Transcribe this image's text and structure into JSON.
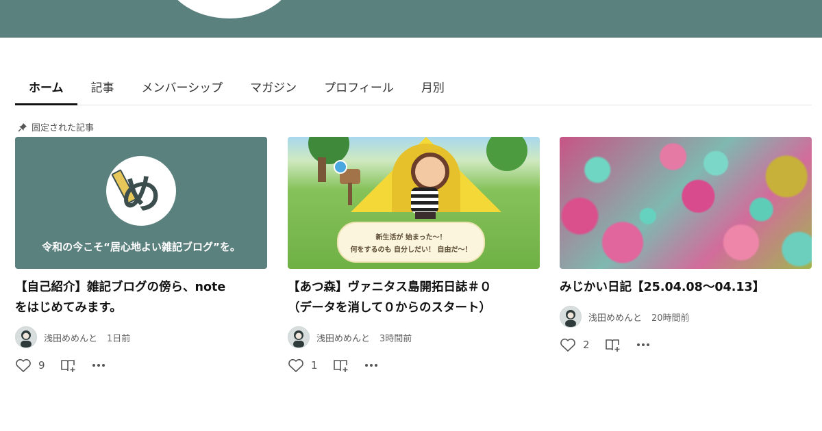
{
  "tabs": [
    {
      "label": "ホーム",
      "active": true
    },
    {
      "label": "記事"
    },
    {
      "label": "メンバーシップ"
    },
    {
      "label": "マガジン"
    },
    {
      "label": "プロフィール"
    },
    {
      "label": "月別"
    }
  ],
  "pinned": {
    "label": "固定された記事"
  },
  "cards": [
    {
      "thumb_logo": "め",
      "thumb_slogan": "令和の今こそ“居心地よい雑記ブログ”を。",
      "title_line1": "【自己紹介】雑記ブログの傍ら、note",
      "title_line2": "をはじめてみます。",
      "author": "浅田めめんと",
      "time": "1日前",
      "likes": "9"
    },
    {
      "thumb_dialog_line1": "新生活が 始まった～！",
      "thumb_dialog_line2": "何をするのも 自分しだい！ 自由だ～！",
      "title_line1": "【あつ森】ヴァニタス島開拓日誌＃０",
      "title_line2": "（データを消して０からのスタート）",
      "author": "浅田めめんと",
      "time": "3時間前",
      "likes": "1"
    },
    {
      "title_line1": "みじかい日記【25.04.08～04.13】",
      "author": "浅田めめんと",
      "time": "20時間前",
      "likes": "2"
    }
  ],
  "icons": {
    "pin": "pin-icon",
    "like": "heart-icon",
    "magazine": "add-to-magazine-icon",
    "more": "more-icon"
  },
  "colors": {
    "brand": "#5b817e",
    "tab_active": "#111111"
  }
}
